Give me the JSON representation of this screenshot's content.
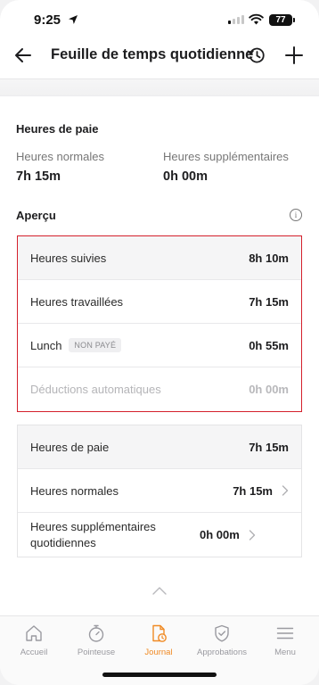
{
  "status_bar": {
    "time": "9:25",
    "battery": "77"
  },
  "header": {
    "title": "Feuille de temps quotidienne"
  },
  "pay_hours": {
    "title": "Heures de paie",
    "normal_label": "Heures normales",
    "normal_value": "7h 15m",
    "overtime_label": "Heures supplémentaires",
    "overtime_value": "0h 00m"
  },
  "overview": {
    "title": "Aperçu",
    "rows": [
      {
        "label": "Heures suivies",
        "value": "8h 10m"
      },
      {
        "label": "Heures travaillées",
        "value": "7h 15m"
      },
      {
        "label": "Lunch",
        "badge": "NON PAYÉ",
        "value": "0h 55m"
      },
      {
        "label": "Déductions automatiques",
        "value": "0h 00m"
      }
    ]
  },
  "pay_table": {
    "rows": [
      {
        "label": "Heures de paie",
        "value": "7h 15m"
      },
      {
        "label": "Heures normales",
        "value": "7h 15m"
      },
      {
        "label": "Heures supplémentaires quotidiennes",
        "value": "0h 00m"
      }
    ]
  },
  "tabbar": {
    "items": [
      {
        "label": "Accueil",
        "icon": "home-icon"
      },
      {
        "label": "Pointeuse",
        "icon": "stopwatch-icon"
      },
      {
        "label": "Journal",
        "icon": "timesheet-icon",
        "active": true
      },
      {
        "label": "Approbations",
        "icon": "shield-check-icon"
      },
      {
        "label": "Menu",
        "icon": "hamburger-icon"
      }
    ]
  },
  "colors": {
    "accent": "#f08a24",
    "highlight_border": "#d4202c"
  }
}
